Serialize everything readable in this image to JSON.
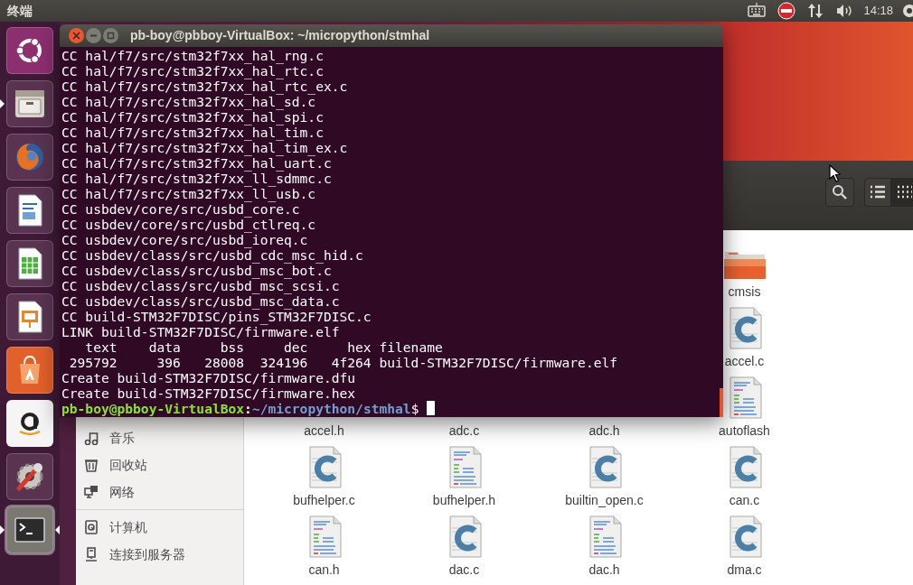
{
  "top_bar": {
    "app_name": "终端",
    "clock": "14:18",
    "indicators": [
      {
        "kind": "keyboard"
      },
      {
        "kind": "blocked"
      },
      {
        "kind": "network"
      },
      {
        "kind": "volume"
      }
    ]
  },
  "launcher": [
    {
      "kind": "dash",
      "running": false,
      "focused": false
    },
    {
      "kind": "files",
      "running": true,
      "focused": false
    },
    {
      "kind": "browser",
      "running": false,
      "focused": false
    },
    {
      "kind": "writer",
      "running": false,
      "focused": false
    },
    {
      "kind": "calc",
      "running": false,
      "focused": false
    },
    {
      "kind": "impress",
      "running": false,
      "focused": false
    },
    {
      "kind": "store",
      "running": false,
      "focused": false
    },
    {
      "kind": "shop",
      "running": false,
      "focused": false
    },
    {
      "kind": "settings",
      "running": false,
      "focused": false
    },
    {
      "kind": "terminal",
      "running": true,
      "focused": true
    }
  ],
  "terminal": {
    "title": "pb-boy@pbboy-VirtualBox: ~/micropython/stmhal",
    "lines": [
      "CC hal/f7/src/stm32f7xx_hal_rng.c",
      "CC hal/f7/src/stm32f7xx_hal_rtc.c",
      "CC hal/f7/src/stm32f7xx_hal_rtc_ex.c",
      "CC hal/f7/src/stm32f7xx_hal_sd.c",
      "CC hal/f7/src/stm32f7xx_hal_spi.c",
      "CC hal/f7/src/stm32f7xx_hal_tim.c",
      "CC hal/f7/src/stm32f7xx_hal_tim_ex.c",
      "CC hal/f7/src/stm32f7xx_hal_uart.c",
      "CC hal/f7/src/stm32f7xx_ll_sdmmc.c",
      "CC hal/f7/src/stm32f7xx_ll_usb.c",
      "CC usbdev/core/src/usbd_core.c",
      "CC usbdev/core/src/usbd_ctlreq.c",
      "CC usbdev/core/src/usbd_ioreq.c",
      "CC usbdev/class/src/usbd_cdc_msc_hid.c",
      "CC usbdev/class/src/usbd_msc_bot.c",
      "CC usbdev/class/src/usbd_msc_scsi.c",
      "CC usbdev/class/src/usbd_msc_data.c",
      "CC build-STM32F7DISC/pins_STM32F7DISC.c",
      "LINK build-STM32F7DISC/firmware.elf",
      "   text    data     bss     dec     hex filename",
      " 295792     396   28008  324196   4f264 build-STM32F7DISC/firmware.elf",
      "Create build-STM32F7DISC/firmware.dfu",
      "Create build-STM32F7DISC/firmware.hex"
    ],
    "prompt": {
      "user_host": "pb-boy@pbboy-VirtualBox",
      "separator": ":",
      "path": "~/micropython/stmhal",
      "symbol": "$"
    }
  },
  "file_manager": {
    "toolbar": [
      {
        "kind": "search",
        "selected": false
      },
      {
        "kind": "list",
        "selected": false
      },
      {
        "kind": "grid",
        "selected": true
      }
    ],
    "sidebar": [
      {
        "items": [
          {
            "kind": "music",
            "label": "音乐"
          },
          {
            "kind": "trash",
            "label": "回收站"
          },
          {
            "kind": "network",
            "label": "网络"
          }
        ]
      },
      {
        "items": [
          {
            "kind": "computer",
            "label": "计算机"
          },
          {
            "kind": "server",
            "label": "连接到服务器"
          }
        ]
      }
    ],
    "files": [
      {
        "name": "cmsis",
        "kind": "folder"
      },
      {
        "name": "accel.c",
        "kind": "c"
      },
      {
        "name": "accel.h"
      },
      {
        "name": "adc.c"
      },
      {
        "name": "adc.h"
      },
      {
        "name": "autoflash",
        "kind": "text"
      },
      {
        "name": "bufhelper.c",
        "kind": "c"
      },
      {
        "name": "bufhelper.h",
        "kind": "text"
      },
      {
        "name": "builtin_open.c",
        "kind": "c"
      },
      {
        "name": "can.c",
        "kind": "c"
      },
      {
        "name": "can.h",
        "kind": "text"
      },
      {
        "name": "dac.c",
        "kind": "c"
      },
      {
        "name": "dac.h",
        "kind": "text"
      },
      {
        "name": "dma.c",
        "kind": "c"
      }
    ]
  }
}
